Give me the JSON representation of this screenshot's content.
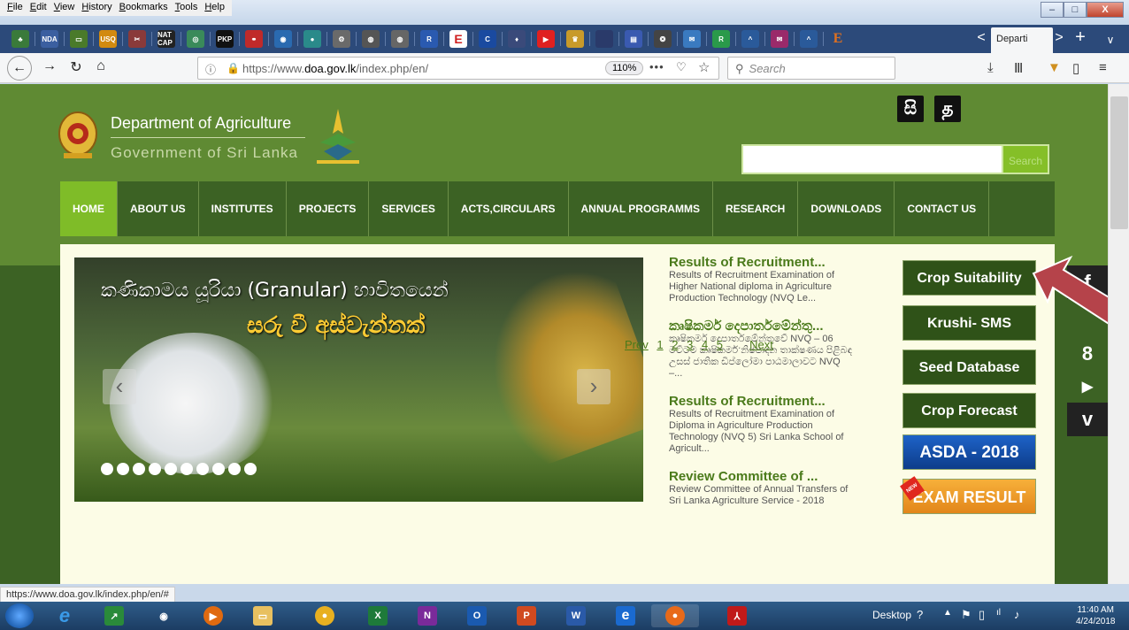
{
  "browser": {
    "menu": [
      "File",
      "Edit",
      "View",
      "History",
      "Bookmarks",
      "Tools",
      "Help"
    ],
    "window_controls": [
      "–",
      "□",
      "X"
    ],
    "bookmark_icons": [
      "NDA",
      "USQ",
      "NAT CAP",
      "PKP",
      "E",
      "C",
      "E"
    ],
    "active_tab": "Departi",
    "tab_nav_left": "<",
    "tab_nav_right": ">",
    "new_tab": "+",
    "url_prefix": "https://www.",
    "url_domain": "doa.gov.lk",
    "url_path": "/index.php/en/",
    "zoom": "110%",
    "page_actions": "•••",
    "search_placeholder": "Search",
    "status_url": "https://www.doa.gov.lk/index.php/en/#"
  },
  "site": {
    "dept_name": "Department of Agriculture",
    "gov_name": "Government of Sri Lanka",
    "lang_si": "සි",
    "lang_ta": "த",
    "search_button": "Search",
    "nav": [
      "HOME",
      "ABOUT US",
      "INSTITUTES",
      "PROJECTS",
      "SERVICES",
      "ACTS,CIRCULARS",
      "ANNUAL PROGRAMMS",
      "RESEARCH",
      "DOWNLOADS",
      "CONTACT US"
    ],
    "slider": {
      "line1": "කණිකාමය යූරියා (Granular) භාවිතයෙන්",
      "line2": "සරු වී අස්වැන්නක්",
      "prev": "‹",
      "next": "›",
      "dot_count": 10
    },
    "news": [
      {
        "title": "Results of Recruitment...",
        "body": "Results of Recruitment Examination of Higher National diploma in Agriculture Production Technology (NVQ Le..."
      },
      {
        "title": "කෘෂිකර්ම දෙපාර්තමේන්තු...",
        "body": "කෘෂිකර්ම දෙපාර්තමේන්තුවේ NVQ – 06 මට්ටම කෘෂිකර්ම නිෂ්පාදන තාක්ෂණය පිළිබඳ උසස් ජාතික ඩිප්ලෝමා පාඨමාලාවට NVQ –..."
      },
      {
        "title": "Results of Recruitment...",
        "body": "Results of Recruitment Examination of Diploma in Agriculture Production Technology (NVQ 5) Sri Lanka School of Agricult..."
      },
      {
        "title": "Review Committee of ...",
        "body": "Review Committee of Annual Transfers of Sri Lanka Agriculture Service - 2018"
      }
    ],
    "pager": {
      "prev": "Prev",
      "pages": [
        "1",
        "2",
        "3",
        "4",
        "5"
      ],
      "ellipsis": "...",
      "next": "Next"
    },
    "quick_links": [
      "Crop Suitability",
      "Krushi- SMS",
      "Seed Database",
      "Crop Forecast"
    ],
    "asda": "ASDA - 2018",
    "exam": "EXAM RESULT",
    "exam_badge": "NEW",
    "social": [
      "f",
      "8",
      "▶",
      "v"
    ]
  },
  "taskbar": {
    "desktop_label": "Desktop",
    "time": "11:40 AM",
    "date": "4/24/2018",
    "apps": [
      "IE",
      "Excel",
      "OneNote",
      "Outlook",
      "PowerPoint",
      "Word",
      "Firefox",
      "Acrobat"
    ],
    "app_letters": {
      "excel": "X",
      "onenote": "N",
      "outlook": "O",
      "powerpoint": "P",
      "word": "W",
      "edge": "e"
    }
  },
  "colors": {
    "header_green": "#5f8a33",
    "nav_green": "#3c6224",
    "active_nav": "#7fbc28",
    "content_bg": "#fcfce6",
    "quick_link_bg": "#2f5218",
    "annotation_arrow": "#b5434a"
  }
}
